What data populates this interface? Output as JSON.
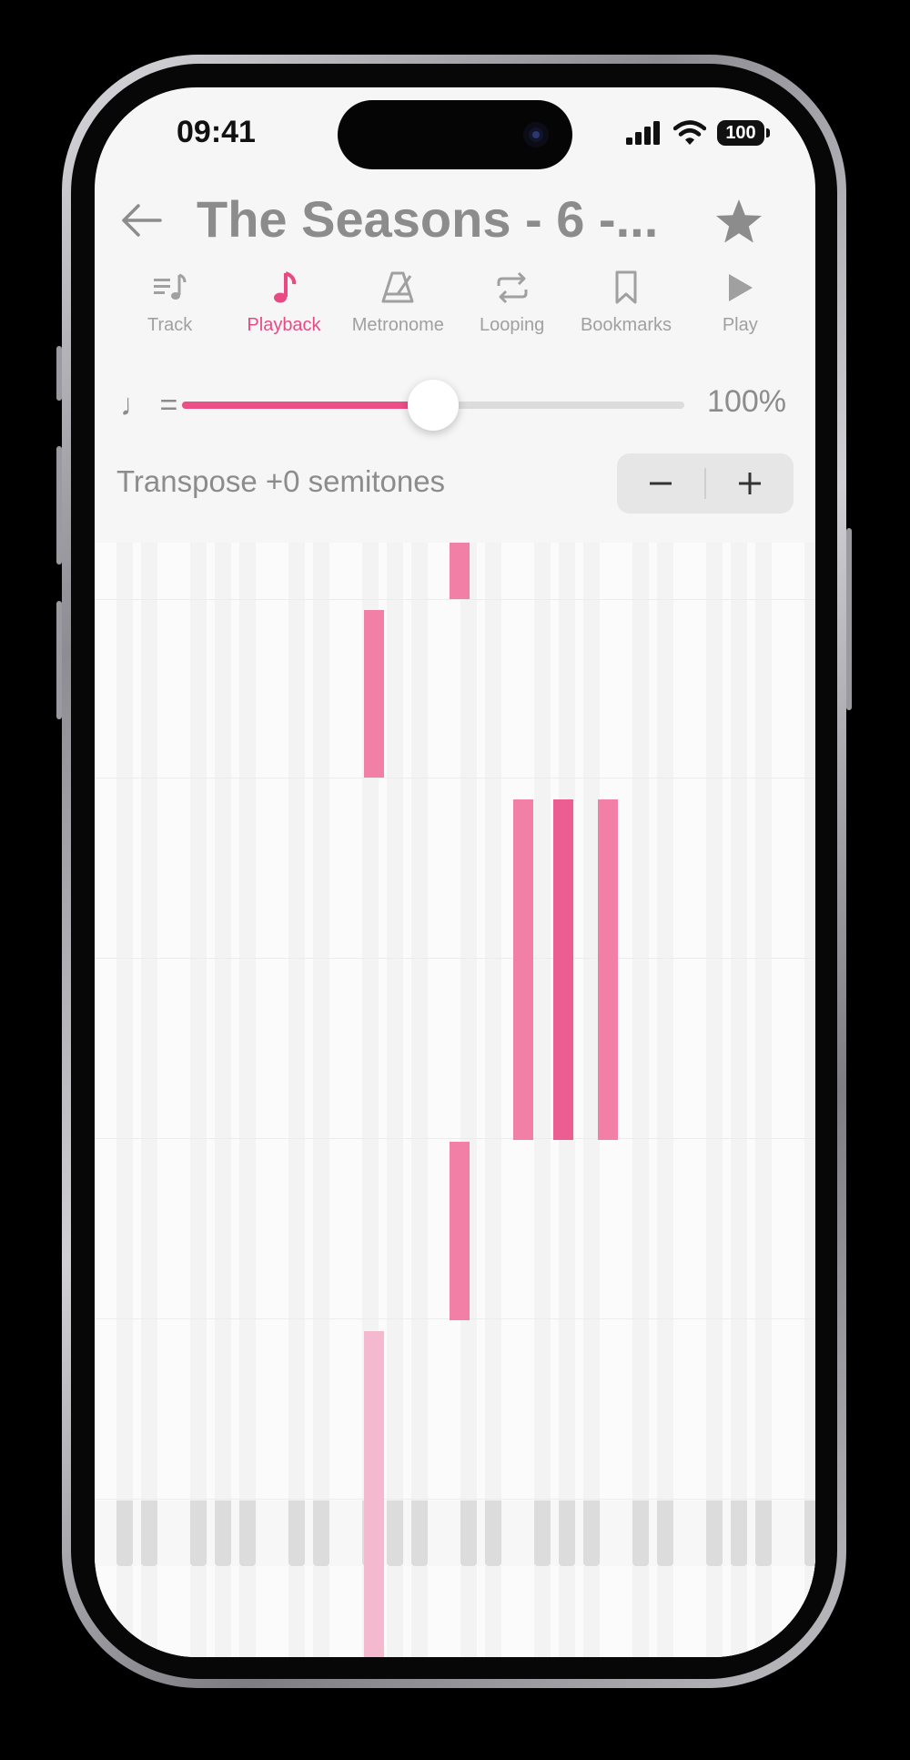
{
  "status_bar": {
    "time": "09:41",
    "battery": "100"
  },
  "header": {
    "title": "The Seasons - 6 -..."
  },
  "tabs": [
    {
      "label": "Track",
      "icon": "track-list-icon",
      "active": false
    },
    {
      "label": "Playback",
      "icon": "music-note-icon",
      "active": true
    },
    {
      "label": "Metronome",
      "icon": "metronome-icon",
      "active": false
    },
    {
      "label": "Looping",
      "icon": "loop-icon",
      "active": false
    },
    {
      "label": "Bookmarks",
      "icon": "bookmark-icon",
      "active": false
    },
    {
      "label": "Play",
      "icon": "play-icon",
      "active": false
    }
  ],
  "tempo": {
    "symbol": "♩ =",
    "value": "100%",
    "level": 0.5
  },
  "transpose": {
    "label": "Transpose +0 semitones",
    "minus": "−",
    "plus": "+"
  },
  "colors": {
    "accent": "#e94a84",
    "note": "#f27fa6",
    "note_dark": "#ec5e92",
    "note_light": "#f5b9cf",
    "text_gray": "#8c8c8c"
  }
}
